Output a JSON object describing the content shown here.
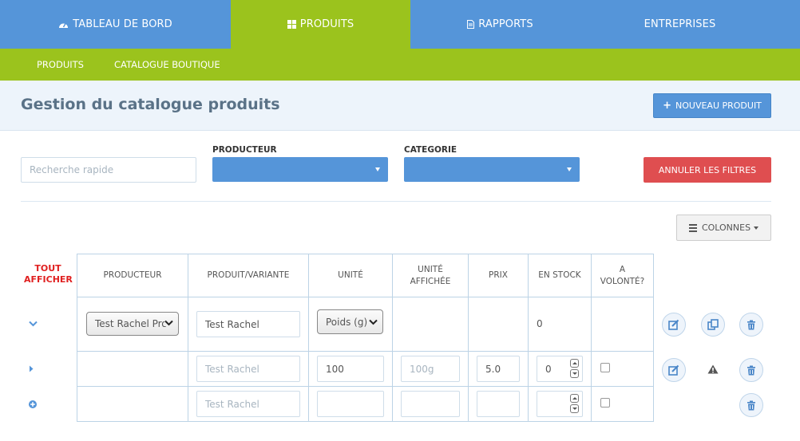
{
  "topnav": {
    "tabs": [
      {
        "label": "TABLEAU DE BORD",
        "icon": "dashboard-icon"
      },
      {
        "label": "PRODUITS",
        "icon": "grid-icon",
        "active": true
      },
      {
        "label": "RAPPORTS",
        "icon": "file-icon"
      },
      {
        "label": "ENTREPRISES"
      }
    ]
  },
  "subnav": {
    "items": [
      {
        "label": "PRODUITS",
        "active": true
      },
      {
        "label": "CATALOGUE BOUTIQUE"
      }
    ]
  },
  "header": {
    "title": "Gestion du catalogue produits",
    "new_product_label": "NOUVEAU PRODUIT"
  },
  "filters": {
    "search_placeholder": "Recherche rapide",
    "producer_label": "PRODUCTEUR",
    "category_label": "CATEGORIE",
    "reset_label": "ANNULER LES FILTRES"
  },
  "columns_button": {
    "label": "COLONNES"
  },
  "table": {
    "show_all_label": "TOUT AFFICHER",
    "headers": [
      "PRODUCTEUR",
      "PRODUIT/VARIANTE",
      "UNITÉ",
      "UNITÉ AFFICHÉE",
      "PRIX",
      "EN STOCK",
      "A VOLONTÉ?"
    ],
    "product_row": {
      "producer": "Test Rachel Pro",
      "product_name": "Test Rachel",
      "unit": "Poids (g)",
      "stock": "0"
    },
    "variant_row": {
      "product_placeholder": "Test Rachel",
      "unit_value": "100",
      "display_unit_placeholder": "100g",
      "price": "5.0",
      "stock": "0"
    },
    "new_row": {
      "product_placeholder": "Test Rachel"
    }
  },
  "colors": {
    "primary_blue": "#5595d9",
    "active_green": "#9bc31d",
    "danger_red": "#df4e50",
    "header_band": "#edf4fb"
  }
}
